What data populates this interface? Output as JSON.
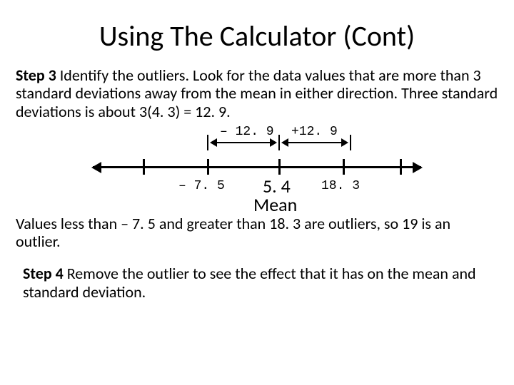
{
  "title": "Using The Calculator (Cont)",
  "step3": {
    "label": "Step 3",
    "text": " Identify the outliers. Look for the data values that are more than 3 standard deviations away from the mean in either direction. Three standard deviations is about 3(4. 3) = 12. 9."
  },
  "diagram": {
    "minus_offset": "– 12. 9",
    "plus_offset": "+12. 9",
    "left_value": "– 7. 5",
    "center_value": "5. 4",
    "center_label": "Mean",
    "right_value": "18. 3"
  },
  "conclusion": "Values less than – 7. 5 and greater than 18. 3 are outliers, so 19 is an outlier.",
  "step4": {
    "label": "Step 4",
    "text": " Remove the outlier to see the effect that it has on the mean and standard deviation."
  }
}
